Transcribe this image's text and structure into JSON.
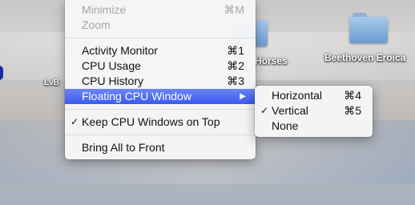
{
  "desktop": {
    "labels": {
      "lvb": "LvB",
      "horses": "Horses",
      "beethoven": "Beethoven Eroica"
    }
  },
  "menu": {
    "minimize": {
      "label": "Minimize",
      "shortcut": "⌘M"
    },
    "zoom": {
      "label": "Zoom"
    },
    "activity_monitor": {
      "label": "Activity Monitor",
      "shortcut": "⌘1"
    },
    "cpu_usage": {
      "label": "CPU Usage",
      "shortcut": "⌘2"
    },
    "cpu_history": {
      "label": "CPU History",
      "shortcut": "⌘3"
    },
    "floating_cpu_window": {
      "label": "Floating CPU Window",
      "arrow": "▶"
    },
    "keep_on_top": {
      "label": "Keep CPU Windows on Top",
      "check": "✓"
    },
    "bring_all": {
      "label": "Bring All to Front"
    }
  },
  "submenu": {
    "horizontal": {
      "label": "Horizontal",
      "shortcut": "⌘4"
    },
    "vertical": {
      "label": "Vertical",
      "shortcut": "⌘5",
      "check": "✓"
    },
    "none": {
      "label": "None"
    }
  },
  "colors": {
    "highlight": "#3b5bf0",
    "folder": "#8fb3d9"
  }
}
